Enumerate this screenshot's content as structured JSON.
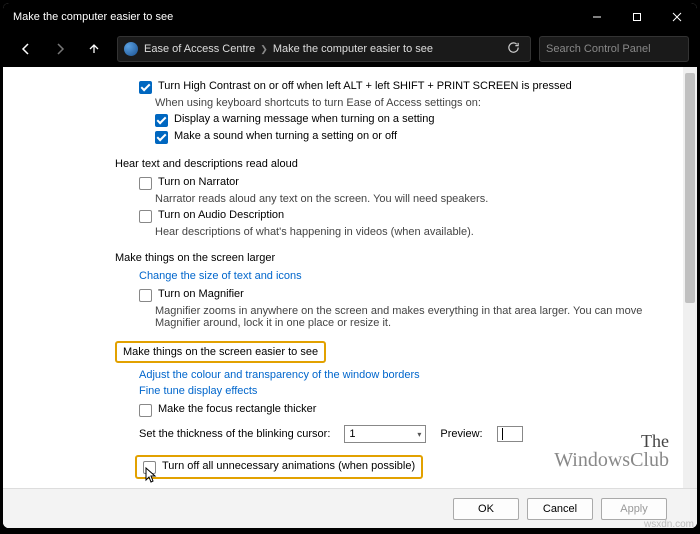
{
  "title": "Make the computer easier to see",
  "breadcrumb": {
    "a": "Ease of Access Centre",
    "b": "Make the computer easier to see"
  },
  "search_placeholder": "Search Control Panel",
  "s1": {
    "hc": "Turn High Contrast on or off when left ALT + left SHIFT + PRINT SCREEN is pressed",
    "sub": "When using keyboard shortcuts to turn Ease of Access settings on:",
    "warn": "Display a warning message when turning on a setting",
    "sound": "Make a sound when turning a setting on or off"
  },
  "s2": {
    "head": "Hear text and descriptions read aloud",
    "narr": "Turn on Narrator",
    "narr_desc": "Narrator reads aloud any text on the screen. You will need speakers.",
    "aud": "Turn on Audio Description",
    "aud_desc": "Hear descriptions of what's happening in videos (when available)."
  },
  "s3": {
    "head": "Make things on the screen larger",
    "link": "Change the size of text and icons",
    "mag": "Turn on Magnifier",
    "mag_desc": "Magnifier zooms in anywhere on the screen and makes everything in that area larger. You can move Magnifier around, lock it in one place or resize it."
  },
  "s4": {
    "head": "Make things on the screen easier to see",
    "link1": "Adjust the colour and transparency of the window borders",
    "link2": "Fine tune display effects",
    "focus": "Make the focus rectangle thicker",
    "cursor_label": "Set the thickness of the blinking cursor:",
    "cursor_val": "1",
    "preview_label": "Preview:",
    "anim": "Turn off all unnecessary animations (when possible)"
  },
  "buttons": {
    "ok": "OK",
    "cancel": "Cancel",
    "apply": "Apply"
  },
  "wm": {
    "l1": "The",
    "l2": "WindowsClub",
    "src": "wsxdn.com"
  }
}
